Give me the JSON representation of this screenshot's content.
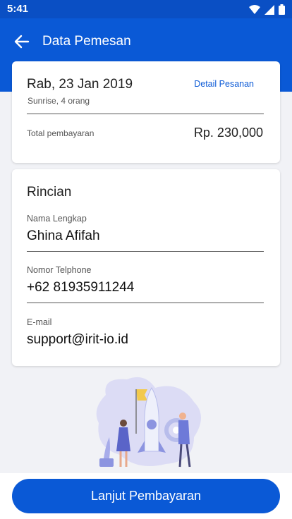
{
  "status_bar": {
    "time": "5:41"
  },
  "app_bar": {
    "title": "Data Pemesan"
  },
  "booking": {
    "date": "Rab, 23 Jan 2019",
    "subtitle": "Sunrise, 4 orang",
    "detail_link": "Detail Pesanan",
    "total_label": "Total pembayaran",
    "total_value": "Rp. 230,000"
  },
  "details": {
    "title": "Rincian",
    "fields": [
      {
        "label": "Nama Lengkap",
        "value": "Ghina Afifah"
      },
      {
        "label": "Nomor Telphone",
        "value": "+62 81935911244"
      },
      {
        "label": "E-mail",
        "value": "support@irit-io.id"
      }
    ]
  },
  "footer": {
    "cta_label": "Lanjut Pembayaran"
  },
  "colors": {
    "primary": "#0a59d6",
    "status_bar": "#0a4fc4",
    "background": "#f1f2f6"
  }
}
